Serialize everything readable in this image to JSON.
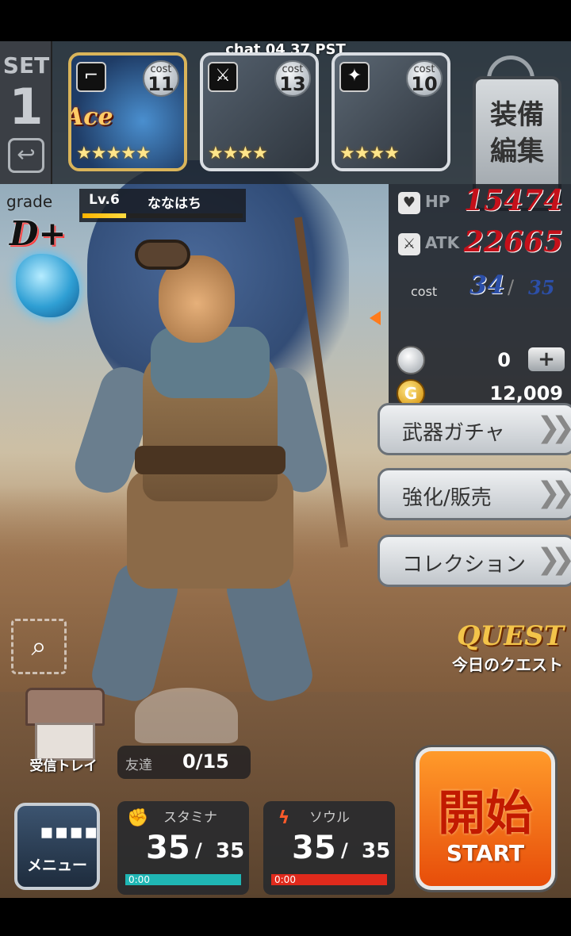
{
  "status": {
    "clock": "chat 04 37 PST"
  },
  "set": {
    "label": "SET",
    "number": "1"
  },
  "equipment": [
    {
      "type_icon": "gun-icon",
      "type_glyph": "⌐",
      "cost_label": "cost",
      "cost": "11",
      "stars": "★★★★★",
      "badge": "Ace",
      "selected": true
    },
    {
      "type_icon": "sword-icon",
      "type_glyph": "⚔",
      "cost_label": "cost",
      "cost": "13",
      "stars": "★★★★",
      "badge": "",
      "selected": false
    },
    {
      "type_icon": "mace-icon",
      "type_glyph": "✦",
      "cost_label": "cost",
      "cost": "10",
      "stars": "★★★★",
      "badge": "",
      "selected": false
    }
  ],
  "edit_button": {
    "line1": "装備",
    "line2": "編集"
  },
  "character": {
    "grade_label": "grade",
    "grade": "D+",
    "level": "Lv.6",
    "name": "ななはち",
    "xp_fraction": 0.27
  },
  "stats": {
    "hp_label": "HP",
    "hp": "15474",
    "atk_label": "ATK",
    "atk": "22665",
    "cost_label": "cost",
    "cost_current": "34",
    "cost_slash": "/",
    "cost_max": "35",
    "silver": "0",
    "gold_glyph": "G",
    "gold": "12,009"
  },
  "menu": {
    "gacha": "武器ガチャ",
    "enhance": "強化/販売",
    "collection": "コレクション",
    "chevron": "❯❯"
  },
  "quest": {
    "title": "QUEST",
    "subtitle": "今日のクエスト"
  },
  "mailbox": {
    "label": "受信トレイ"
  },
  "friends": {
    "label": "友達",
    "value": "0/15"
  },
  "main_menu": {
    "label": "メニュー",
    "grid_glyph": "▪▪▪▪"
  },
  "stamina": {
    "label": "スタミナ",
    "current": "35",
    "slash": "/",
    "max": "35",
    "timer": "0:00",
    "fraction": 1.0,
    "color": "#1fb6b4"
  },
  "soul": {
    "label": "ソウル",
    "current": "35",
    "slash": "/",
    "max": "35",
    "timer": "0:00",
    "fraction": 1.0,
    "color": "#e02a1c"
  },
  "start": {
    "jp": "開始",
    "en": "START"
  }
}
